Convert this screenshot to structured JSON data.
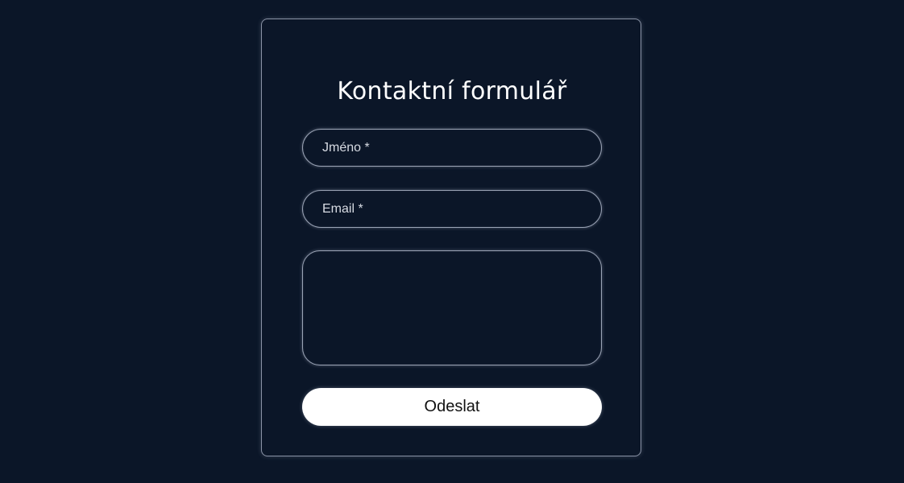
{
  "form": {
    "title": "Kontaktní formulář",
    "name_placeholder": "Jméno *",
    "name_value": "",
    "email_placeholder": "Email *",
    "email_value": "",
    "message_placeholder": "",
    "message_value": "",
    "submit_label": "Odeslat"
  },
  "colors": {
    "background": "#0b1628",
    "border": "#9aa3b5",
    "button": "#ffffff",
    "text": "#ffffff"
  }
}
